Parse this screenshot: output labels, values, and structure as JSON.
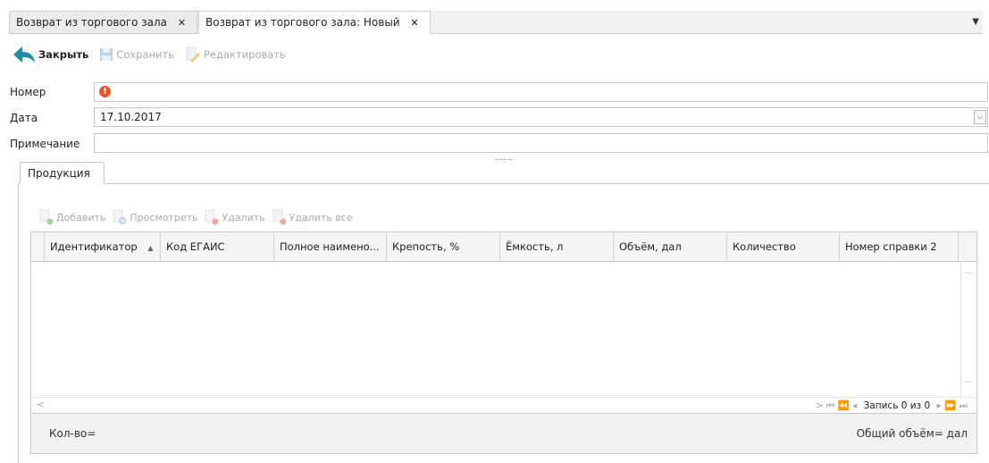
{
  "tabs": [
    {
      "label": "Возврат из торгового зала"
    },
    {
      "label": "Возврат из торгового зала: Новый"
    }
  ],
  "toolbar": {
    "close_label": "Закрыть",
    "save_label": "Сохранить",
    "edit_label": "Редактировать"
  },
  "form": {
    "number_label": "Номер",
    "date_label": "Дата",
    "date_value": "17.10.2017",
    "note_label": "Примечание"
  },
  "products_tab": {
    "label": "Продукция"
  },
  "products_toolbar": {
    "add_label": "Добавить",
    "view_label": "Просмотреть",
    "delete_label": "Удалить",
    "delete_all_label": "Удалить все"
  },
  "grid": {
    "columns": [
      {
        "label": "Идентификатор"
      },
      {
        "label": "Код ЕГАИС"
      },
      {
        "label": "Полное наимено..."
      },
      {
        "label": "Крепость, %"
      },
      {
        "label": "Ёмкость, л"
      },
      {
        "label": "Объём, дал"
      },
      {
        "label": "Количество"
      },
      {
        "label": "Номер справки 2"
      }
    ],
    "sort_glyph": "▲",
    "pager_text": "Запись 0 из 0"
  },
  "footer": {
    "count_label": "Кол-во=",
    "volume_label": "Общий объём= дал"
  },
  "colors": {
    "accent": "#1f8fa6",
    "error": "#e4572e"
  }
}
